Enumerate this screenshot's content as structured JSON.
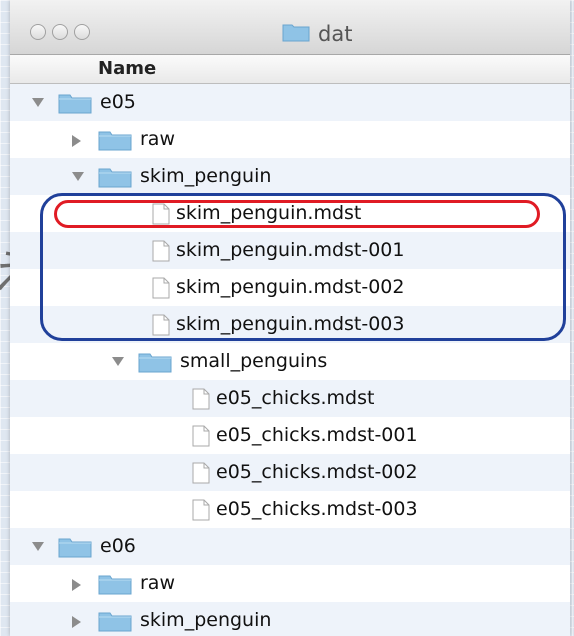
{
  "window": {
    "title": "dat"
  },
  "column": {
    "name": "Name"
  },
  "background_glyph": "え",
  "tree": [
    {
      "label": "e05",
      "kind": "folder",
      "expanded": true
    },
    {
      "label": "raw",
      "kind": "folder",
      "expanded": false
    },
    {
      "label": "skim_penguin",
      "kind": "folder",
      "expanded": true
    },
    {
      "label": "skim_penguin.mdst",
      "kind": "file"
    },
    {
      "label": "skim_penguin.mdst-001",
      "kind": "file"
    },
    {
      "label": "skim_penguin.mdst-002",
      "kind": "file"
    },
    {
      "label": "skim_penguin.mdst-003",
      "kind": "file"
    },
    {
      "label": "small_penguins",
      "kind": "folder",
      "expanded": true
    },
    {
      "label": "e05_chicks.mdst",
      "kind": "file"
    },
    {
      "label": "e05_chicks.mdst-001",
      "kind": "file"
    },
    {
      "label": "e05_chicks.mdst-002",
      "kind": "file"
    },
    {
      "label": "e05_chicks.mdst-003",
      "kind": "file"
    },
    {
      "label": "e06",
      "kind": "folder",
      "expanded": true
    },
    {
      "label": "raw",
      "kind": "folder",
      "expanded": false
    },
    {
      "label": "skim_penguin",
      "kind": "folder",
      "expanded": false
    }
  ],
  "colors": {
    "highlight_red": "#e01b24",
    "highlight_blue": "#20409a",
    "folder": "#8fc3e6"
  }
}
